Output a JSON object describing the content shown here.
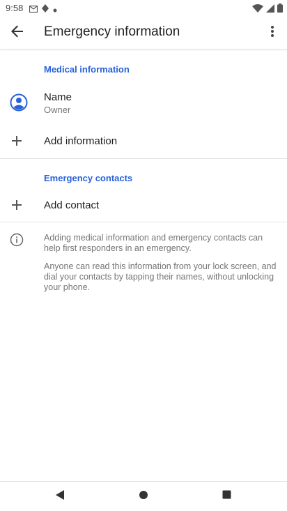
{
  "status_bar": {
    "time": "9:58",
    "icons": [
      "gmail-icon",
      "signal-alt-icon",
      "dot-icon"
    ],
    "right_icons": [
      "wifi-icon",
      "cell-signal-icon",
      "battery-icon"
    ]
  },
  "app_bar": {
    "title": "Emergency information",
    "back_icon": "arrow-back-icon",
    "more_icon": "more-vert-icon"
  },
  "medical_section": {
    "header": "Medical information",
    "name_row": {
      "label": "Name",
      "value": "Owner"
    },
    "add_info_label": "Add information"
  },
  "contacts_section": {
    "header": "Emergency contacts",
    "add_contact_label": "Add contact"
  },
  "info": {
    "text_1": "Adding medical information and emergency contacts can help first responders in an emergency.",
    "text_2": "Anyone can read this information from your lock screen, and dial your contacts by tapping their names, without unlocking your phone."
  },
  "nav_bar": {
    "buttons": [
      "back-triangle-icon",
      "home-circle-icon",
      "recents-square-icon"
    ]
  },
  "colors": {
    "accent": "#2962d9",
    "divider": "#e3e3e3",
    "secondary_text": "#757575"
  }
}
